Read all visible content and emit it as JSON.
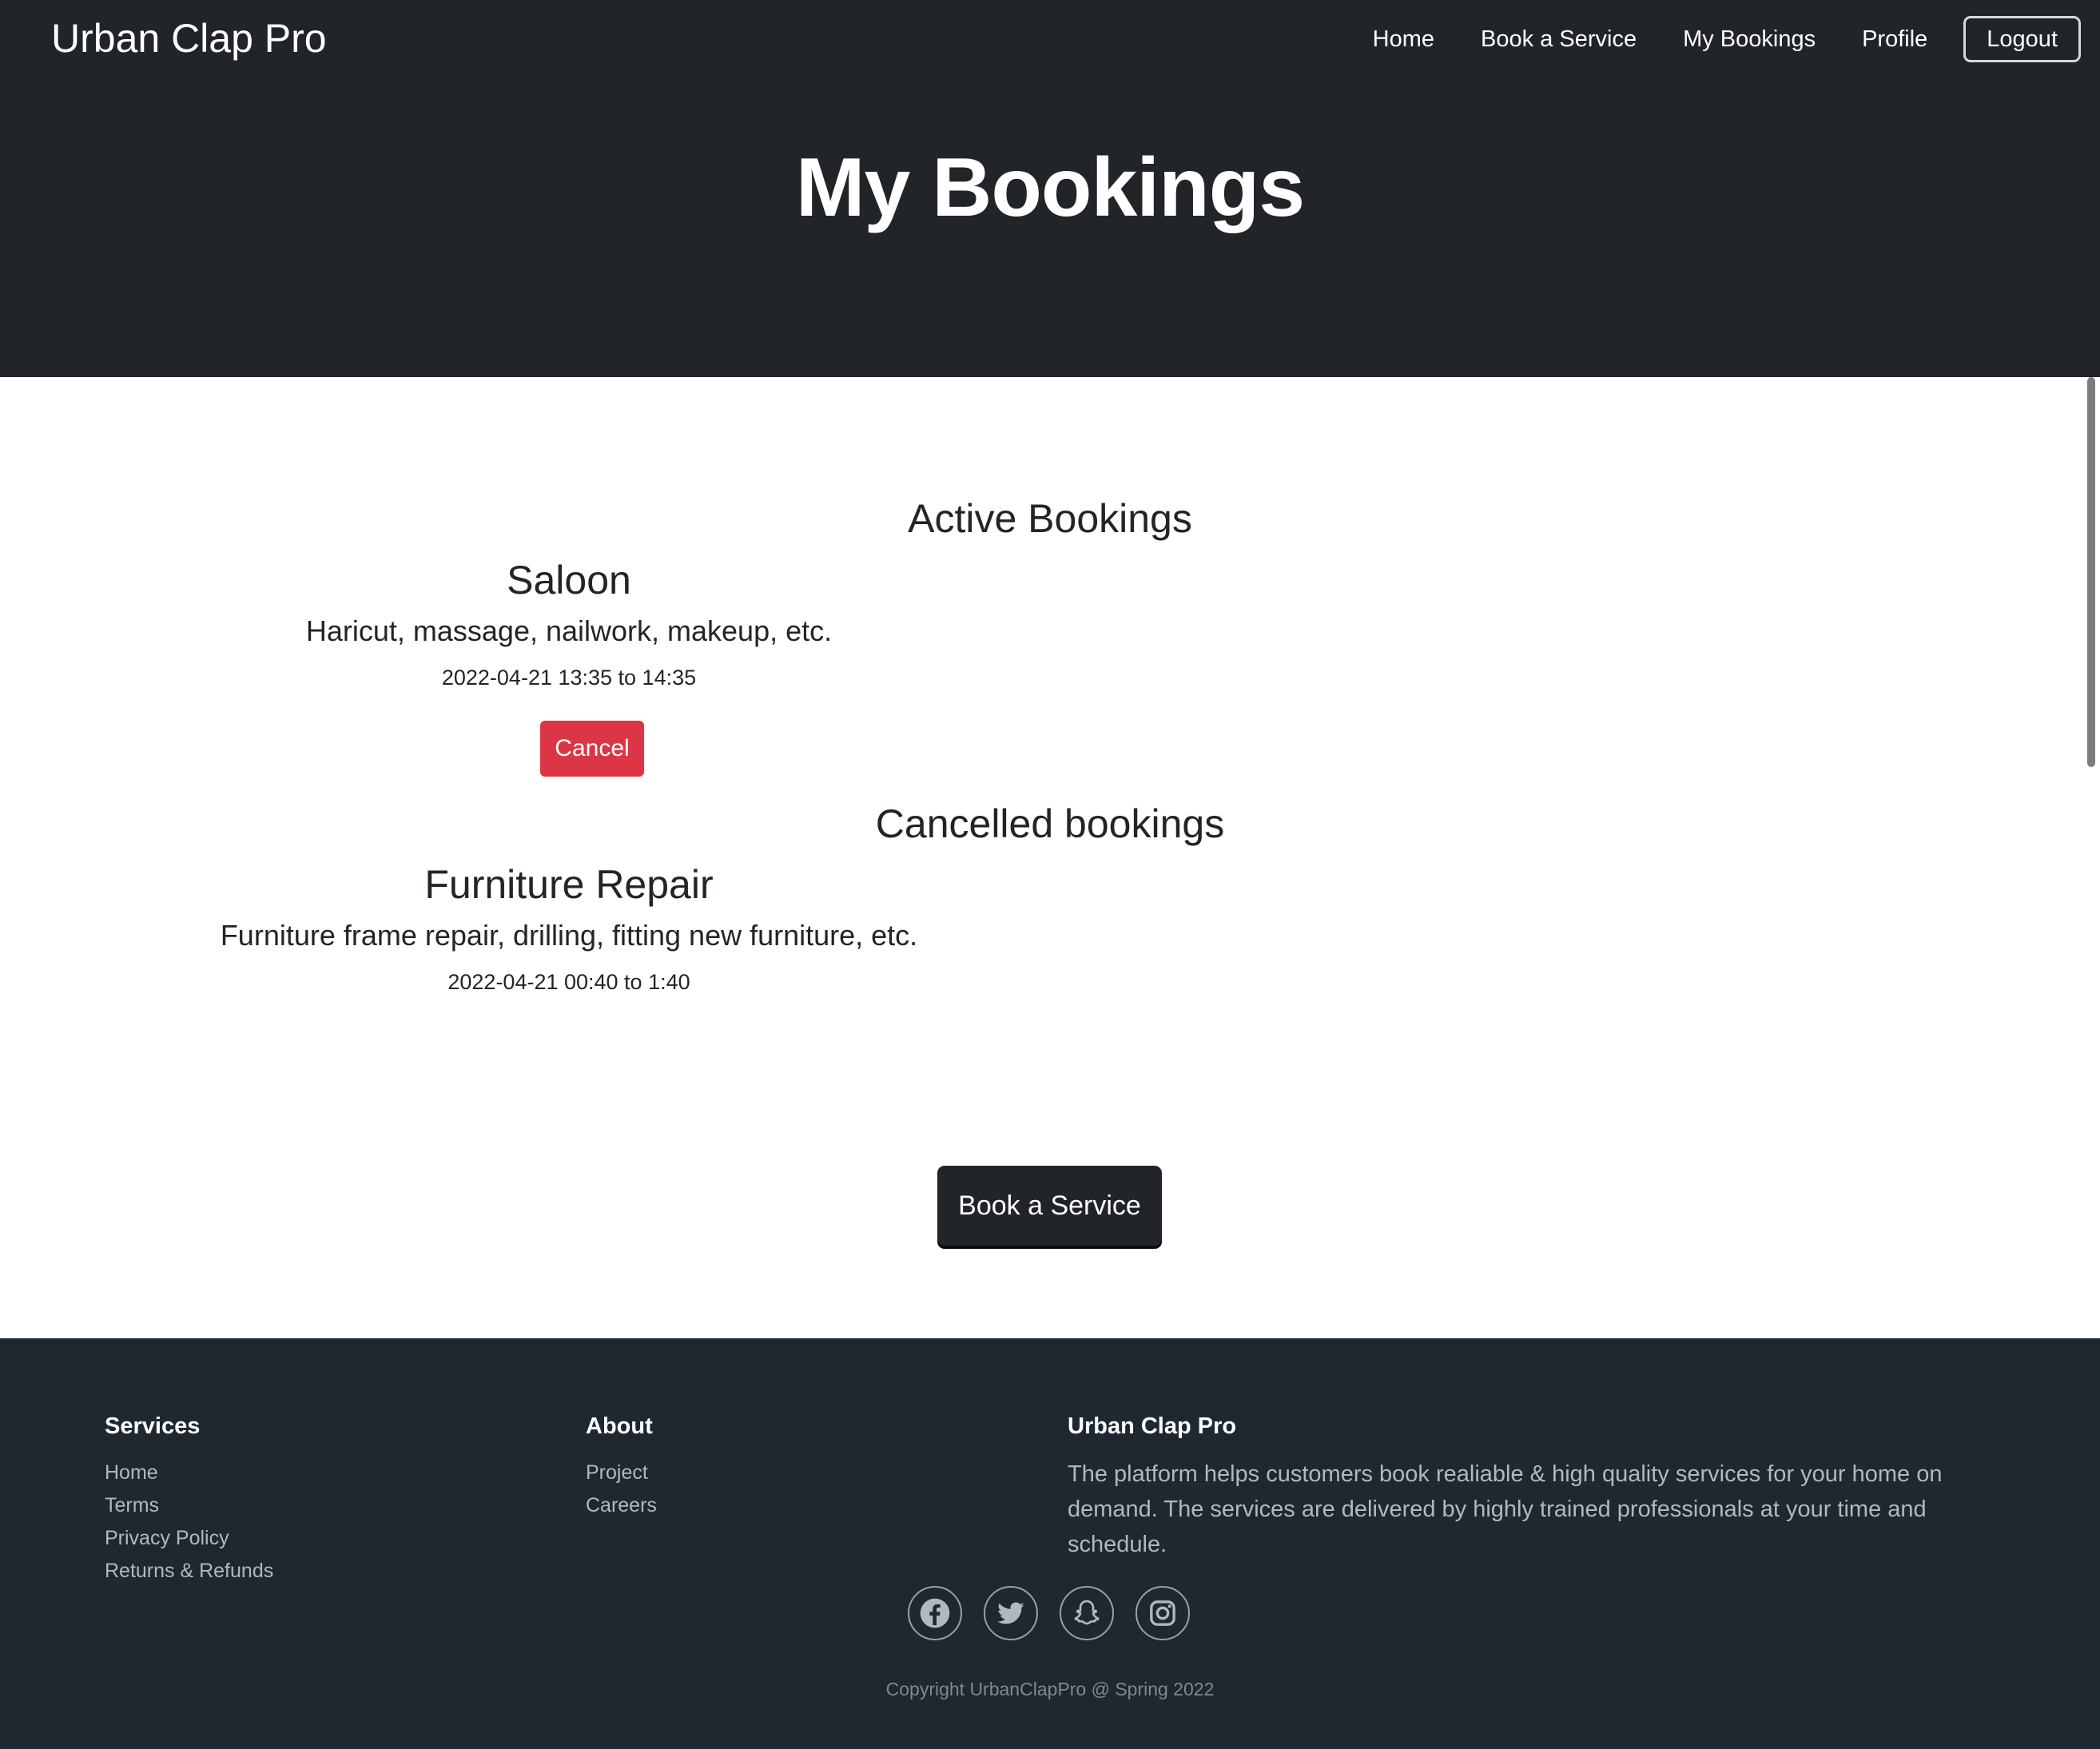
{
  "header": {
    "brand": "Urban Clap Pro",
    "nav": {
      "home": "Home",
      "book_service": "Book a Service",
      "my_bookings": "My Bookings",
      "profile": "Profile",
      "logout": "Logout"
    },
    "title": "My Bookings"
  },
  "active": {
    "heading": "Active Bookings",
    "items": [
      {
        "name": "Saloon",
        "description": "Haricut, massage, nailwork, makeup, etc.",
        "time": "2022-04-21 13:35 to 14:35",
        "cancel_label": "Cancel"
      }
    ]
  },
  "cancelled": {
    "heading": "Cancelled bookings",
    "items": [
      {
        "name": "Furniture Repair",
        "description": "Furniture frame repair, drilling, fitting new furniture, etc.",
        "time": "2022-04-21 00:40 to 1:40"
      }
    ]
  },
  "cta": {
    "book_service": "Book a Service"
  },
  "footer": {
    "services": {
      "heading": "Services",
      "links": [
        "Home",
        "Terms",
        "Privacy Policy",
        "Returns & Refunds"
      ]
    },
    "about": {
      "heading": "About",
      "links": [
        "Project",
        "Careers"
      ]
    },
    "brand": {
      "heading": "Urban Clap Pro",
      "text": "The platform helps customers book realiable & high quality services for your home on demand. The services are delivered by highly trained professionals at your time and schedule."
    },
    "socials": [
      "facebook-icon",
      "twitter-icon",
      "snapchat-icon",
      "instagram-icon"
    ],
    "copyright": "Copyright UrbanClapPro @ Spring 2022"
  },
  "colors": {
    "dark": "#212529",
    "footer": "#1f2731",
    "danger": "#dc3545",
    "white": "#ffffff",
    "muted": "#b3b8bd"
  }
}
